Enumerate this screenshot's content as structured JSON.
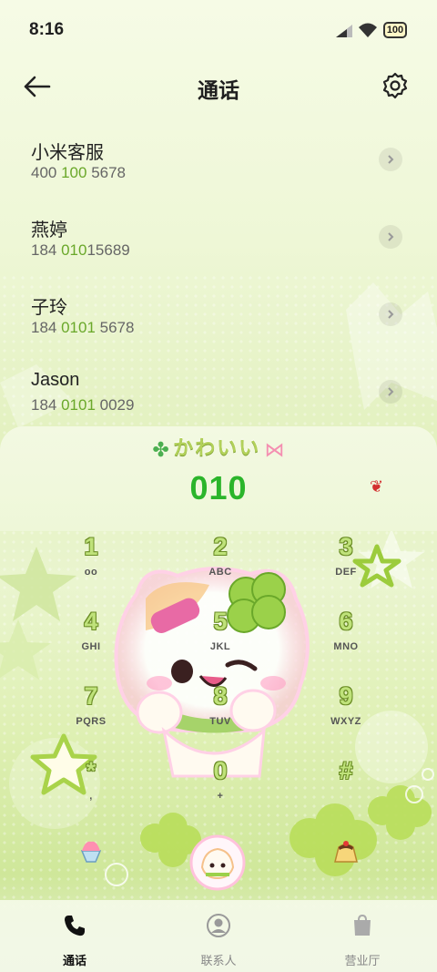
{
  "status_bar": {
    "time": "8:16",
    "battery": "100"
  },
  "header": {
    "title": "通话"
  },
  "calls": [
    {
      "name": "小米客服",
      "number_parts": [
        "400 ",
        "100",
        " 5678"
      ]
    },
    {
      "name": "燕婷",
      "number_parts": [
        "184 ",
        "010",
        "15689"
      ]
    },
    {
      "name": "子玲",
      "number_parts": [
        "184 ",
        "0101",
        " 5678"
      ]
    },
    {
      "name": "Jason",
      "number_parts": [
        "184 ",
        "0101",
        " 0029"
      ]
    }
  ],
  "dialer": {
    "banner": "かわいい",
    "number": "010",
    "keys": [
      {
        "digit": "1",
        "letters": "oo"
      },
      {
        "digit": "2",
        "letters": "ABC"
      },
      {
        "digit": "3",
        "letters": "DEF"
      },
      {
        "digit": "4",
        "letters": "GHI"
      },
      {
        "digit": "5",
        "letters": "JKL"
      },
      {
        "digit": "6",
        "letters": "MNO"
      },
      {
        "digit": "7",
        "letters": "PQRS"
      },
      {
        "digit": "8",
        "letters": "TUV"
      },
      {
        "digit": "9",
        "letters": "WXYZ"
      },
      {
        "digit": "*",
        "letters": ","
      },
      {
        "digit": "0",
        "letters": "+"
      },
      {
        "digit": "#",
        "letters": ""
      }
    ]
  },
  "bottom_nav": [
    {
      "label": "通话",
      "icon": "phone-icon",
      "active": true
    },
    {
      "label": "联系人",
      "icon": "person-icon",
      "active": false
    },
    {
      "label": "营业厅",
      "icon": "bag-icon",
      "active": false
    }
  ],
  "colors": {
    "accent_green": "#2bb52b",
    "number_highlight": "#6aa82a",
    "key_fill": "#bfe27a"
  }
}
